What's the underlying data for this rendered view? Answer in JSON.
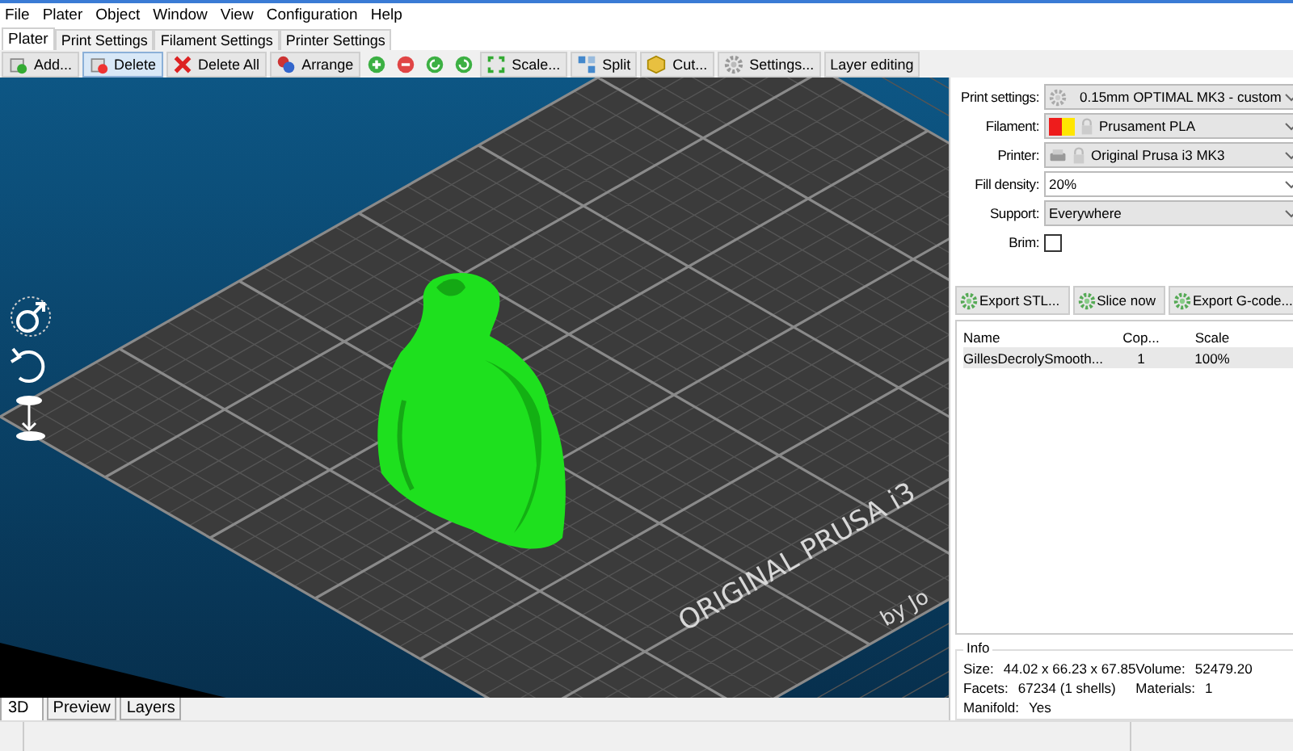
{
  "menu": [
    "File",
    "Plater",
    "Object",
    "Window",
    "View",
    "Configuration",
    "Help"
  ],
  "tabs": [
    {
      "label": "Plater",
      "selected": true
    },
    {
      "label": "Print Settings",
      "selected": false
    },
    {
      "label": "Filament Settings",
      "selected": false
    },
    {
      "label": "Printer Settings",
      "selected": false
    }
  ],
  "toolbar": [
    {
      "kind": "text",
      "label": "Add...",
      "highlighted": false
    },
    {
      "kind": "text",
      "label": "Delete",
      "highlighted": true
    },
    {
      "kind": "text",
      "label": "Delete All",
      "highlighted": false
    },
    {
      "kind": "text",
      "label": "Arrange",
      "highlighted": false
    },
    {
      "kind": "icon",
      "highlighted": false
    },
    {
      "kind": "icon",
      "highlighted": false
    },
    {
      "kind": "icon",
      "highlighted": false
    },
    {
      "kind": "icon",
      "highlighted": false
    },
    {
      "kind": "text",
      "label": "Scale...",
      "highlighted": false
    },
    {
      "kind": "text",
      "label": "Split",
      "highlighted": false
    },
    {
      "kind": "text",
      "label": "Cut...",
      "highlighted": false
    },
    {
      "kind": "text",
      "label": "Settings...",
      "highlighted": false
    },
    {
      "kind": "text",
      "label": "Layer editing",
      "highlighted": false
    }
  ],
  "viewport": {
    "bed_text": [
      "ORIGINAL PRUSA i3",
      "by Jo"
    ]
  },
  "settings": [
    {
      "kind": "preset",
      "label": "Print settings:",
      "locked": false,
      "value": "0.15mm OPTIMAL MK3 - custom"
    },
    {
      "kind": "preset",
      "label": "Filament:",
      "swatches": [
        {
          "color": "#ee1c1c"
        },
        {
          "color": "#ffe600"
        }
      ],
      "locked": true,
      "value": "Prusament PLA"
    },
    {
      "kind": "preset",
      "label": "Printer:",
      "locked": true,
      "value": "Original Prusa i3 MK3"
    },
    {
      "kind": "edit_combo",
      "label": "Fill density:",
      "value": "20%"
    },
    {
      "kind": "combo",
      "label": "Support:",
      "value": "Everywhere"
    },
    {
      "kind": "checkbox",
      "label": "Brim:",
      "checked": false
    }
  ],
  "actions": [
    "Export STL...",
    "Slice now",
    "Export G-code..."
  ],
  "objects": {
    "columns": [
      "Name",
      "Cop...",
      "Scale"
    ],
    "rows": [
      {
        "cells": [
          "GillesDecrolySmooth...",
          "1",
          "100%"
        ],
        "selected": true
      }
    ]
  },
  "info": {
    "title": "Info",
    "fields": [
      {
        "label": "Size:",
        "value": "44.02 x 66.23 x 67.85"
      },
      {
        "label": "Volume:",
        "value": "52479.20"
      },
      {
        "label": "Facets:",
        "value": "67234 (1 shells)"
      },
      {
        "label": "Materials:",
        "value": "1"
      },
      {
        "label": "Manifold:",
        "value": "Yes"
      }
    ]
  },
  "bottom_tabs": [
    {
      "label": "3D",
      "selected": true
    },
    {
      "label": "Preview",
      "selected": false
    },
    {
      "label": "Layers",
      "selected": false
    }
  ]
}
